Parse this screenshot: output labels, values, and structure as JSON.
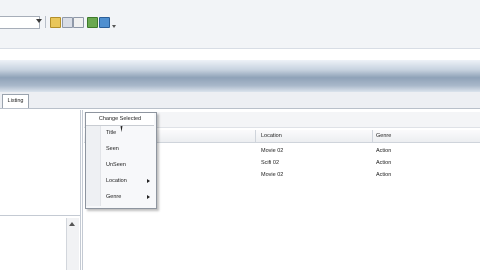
{
  "tabs": {
    "listing": "Listing"
  },
  "context_menu": {
    "header": "Change Selected",
    "items": [
      {
        "label": "Title"
      },
      {
        "label": "Seen"
      },
      {
        "label": "UnSeen"
      },
      {
        "label": "Location"
      },
      {
        "label": "Genre"
      }
    ]
  },
  "grid": {
    "columns": {
      "location": "Location",
      "genre": "Genre"
    },
    "rows": [
      {
        "location": "Movie 02",
        "genre": "Action"
      },
      {
        "location": "Scifi 02",
        "genre": "Action"
      },
      {
        "location": "Movie 02",
        "genre": "Action"
      }
    ]
  },
  "toolbar": {
    "icons": [
      "dropdown-arrow-icon",
      "folder-icon",
      "wand-icon",
      "check-icon",
      "grid-icon",
      "chart-icon",
      "overflow-arrow-icon"
    ]
  },
  "colors": {
    "menu_border": "#8e959f",
    "band": "#8fa2b8"
  }
}
